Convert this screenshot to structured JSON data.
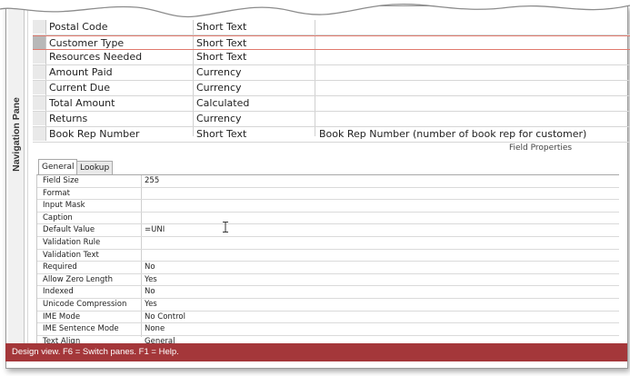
{
  "navigation_pane": {
    "label": "Navigation Pane"
  },
  "fields": [
    {
      "name": "Postal Code",
      "type": "Short Text",
      "description": ""
    },
    {
      "name": "Customer Type",
      "type": "Short Text",
      "description": "",
      "current": true
    },
    {
      "name": "Resources Needed",
      "type": "Short Text",
      "description": ""
    },
    {
      "name": "Amount Paid",
      "type": "Currency",
      "description": ""
    },
    {
      "name": "Current Due",
      "type": "Currency",
      "description": ""
    },
    {
      "name": "Total Amount",
      "type": "Calculated",
      "description": ""
    },
    {
      "name": "Returns",
      "type": "Currency",
      "description": ""
    },
    {
      "name": "Book Rep Number",
      "type": "Short Text",
      "description": "Book Rep Number (number of book rep for customer)"
    }
  ],
  "field_properties_label": "Field Properties",
  "tabs": [
    {
      "label": "General",
      "active": true
    },
    {
      "label": "Lookup",
      "active": false
    }
  ],
  "properties": [
    {
      "name": "Field Size",
      "value": "255"
    },
    {
      "name": "Format",
      "value": ""
    },
    {
      "name": "Input Mask",
      "value": ""
    },
    {
      "name": "Caption",
      "value": ""
    },
    {
      "name": "Default Value",
      "value": "=UNI"
    },
    {
      "name": "Validation Rule",
      "value": ""
    },
    {
      "name": "Validation Text",
      "value": ""
    },
    {
      "name": "Required",
      "value": "No"
    },
    {
      "name": "Allow Zero Length",
      "value": "Yes"
    },
    {
      "name": "Indexed",
      "value": "No"
    },
    {
      "name": "Unicode Compression",
      "value": "Yes"
    },
    {
      "name": "IME Mode",
      "value": "No Control"
    },
    {
      "name": "IME Sentence Mode",
      "value": "None"
    },
    {
      "name": "Text Align",
      "value": "General"
    }
  ],
  "status_bar": {
    "text": "Design view.  F6 = Switch panes.  F1 = Help."
  },
  "colors": {
    "status_bar": "#a4373a",
    "current_row_border": "#e07a6e"
  }
}
